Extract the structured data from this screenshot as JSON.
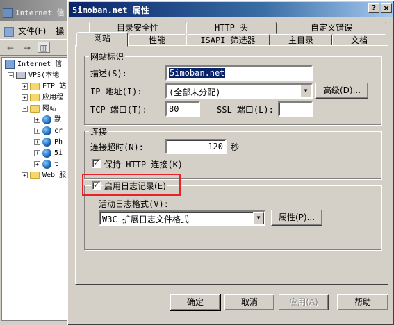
{
  "mmc": {
    "title": "Internet 信",
    "menu": {
      "file": "文件(F)",
      "op": "操"
    },
    "tree": {
      "root": "Internet 信",
      "server": "VPS(本地",
      "ftp": "FTP 站",
      "apppool": "应用程",
      "websites": "网站",
      "site1": "默",
      "site2": "cr",
      "site3": "Ph",
      "site4": "5i",
      "site5": "t",
      "webext": "Web 服"
    }
  },
  "dialog": {
    "title": "5imoban.net 属性",
    "help_btn": "?",
    "close_btn": "×",
    "tabs_back": [
      "目录安全性",
      "HTTP 头",
      "自定义错误"
    ],
    "tabs_front": [
      "网站",
      "性能",
      "ISAPI 筛选器",
      "主目录",
      "文档"
    ],
    "site_id_group": {
      "legend": "网站标识",
      "description_label": "描述(S):",
      "description_value": "5imoban.net",
      "ip_label": "IP 地址(I):",
      "ip_value": "(全部未分配)",
      "advanced_button": "高级(D)...",
      "tcp_port_label": "TCP 端口(T):",
      "tcp_port_value": "80",
      "ssl_port_label": "SSL 端口(L):",
      "ssl_port_value": ""
    },
    "connection_group": {
      "legend": "连接",
      "timeout_label": "连接超时(N):",
      "timeout_value": "120",
      "timeout_unit": "秒",
      "keepalive_label": "保持 HTTP 连接(K)",
      "keepalive_checked": true
    },
    "logging_group": {
      "enable_label": "启用日志记录(E)",
      "enable_checked": true,
      "format_label": "活动日志格式(V):",
      "format_value": "W3C 扩展日志文件格式",
      "properties_button": "属性(P)..."
    },
    "buttons": {
      "ok": "确定",
      "cancel": "取消",
      "apply": "应用(A)",
      "help": "帮助"
    },
    "highlight_color": "#e8202a"
  }
}
